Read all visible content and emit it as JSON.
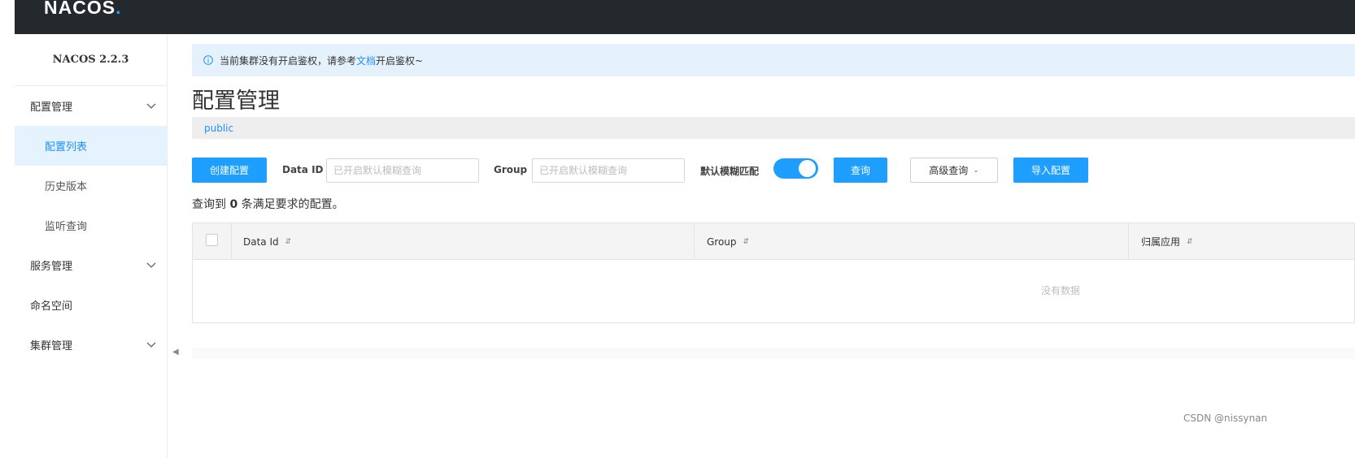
{
  "header": {
    "logo_text": "NACOS",
    "logo_dot": "."
  },
  "sidebar": {
    "version": "NACOS 2.2.3",
    "groups": [
      {
        "label": "配置管理",
        "expanded": true,
        "items": [
          {
            "label": "配置列表",
            "active": true
          },
          {
            "label": "历史版本",
            "active": false
          },
          {
            "label": "监听查询",
            "active": false
          }
        ]
      },
      {
        "label": "服务管理",
        "expanded": false
      },
      {
        "label": "命名空间"
      },
      {
        "label": "集群管理",
        "expanded": false
      }
    ]
  },
  "alert": {
    "prefix": "当前集群没有开启鉴权，请参考",
    "link": "文档",
    "suffix": "开启鉴权~"
  },
  "page": {
    "title": "配置管理",
    "namespace": "public"
  },
  "toolbar": {
    "create_button": "创建配置",
    "dataid_label": "Data ID",
    "dataid_placeholder": "已开启默认模糊查询",
    "group_label": "Group",
    "group_placeholder": "已开启默认模糊查询",
    "fuzzy_label": "默认模糊匹配",
    "fuzzy_enabled": true,
    "query_button": "查询",
    "advanced_button": "高级查询",
    "import_button": "导入配置"
  },
  "result": {
    "prefix": "查询到",
    "count": "0",
    "suffix": "条满足要求的配置。"
  },
  "table": {
    "columns": [
      "Data Id",
      "Group",
      "归属应用"
    ],
    "empty_text": "没有数据"
  },
  "watermark": "CSDN @nissynan",
  "colors": {
    "primary": "#1e9fff",
    "topbar": "#24292e",
    "alert_bg": "#e5f2fd",
    "active_bg": "#e4f3fe"
  }
}
